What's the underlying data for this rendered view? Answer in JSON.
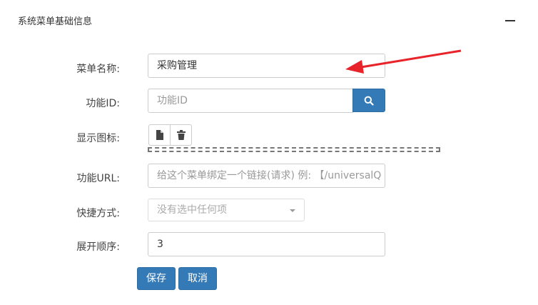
{
  "panel": {
    "title": "系统菜单基础信息"
  },
  "form": {
    "menu_name": {
      "label": "菜单名称:",
      "value": "采购管理"
    },
    "function_id": {
      "label": "功能ID:",
      "placeholder": "功能ID"
    },
    "display_icon": {
      "label": "显示图标:"
    },
    "function_url": {
      "label": "功能URL:",
      "placeholder": "给这个菜单绑定一个链接(请求) 例: 【/universalQ"
    },
    "shortcut": {
      "label": "快捷方式:",
      "selected": "没有选中任何项"
    },
    "order": {
      "label": "展开顺序:",
      "value": "3"
    }
  },
  "actions": {
    "save_label": "保存",
    "cancel_label": "取消"
  },
  "colors": {
    "primary": "#337ab7",
    "annotation_arrow": "#e8232a"
  },
  "icons": {
    "collapse": "minus-icon",
    "search": "search-icon",
    "file": "file-icon",
    "trash": "trash-icon"
  }
}
